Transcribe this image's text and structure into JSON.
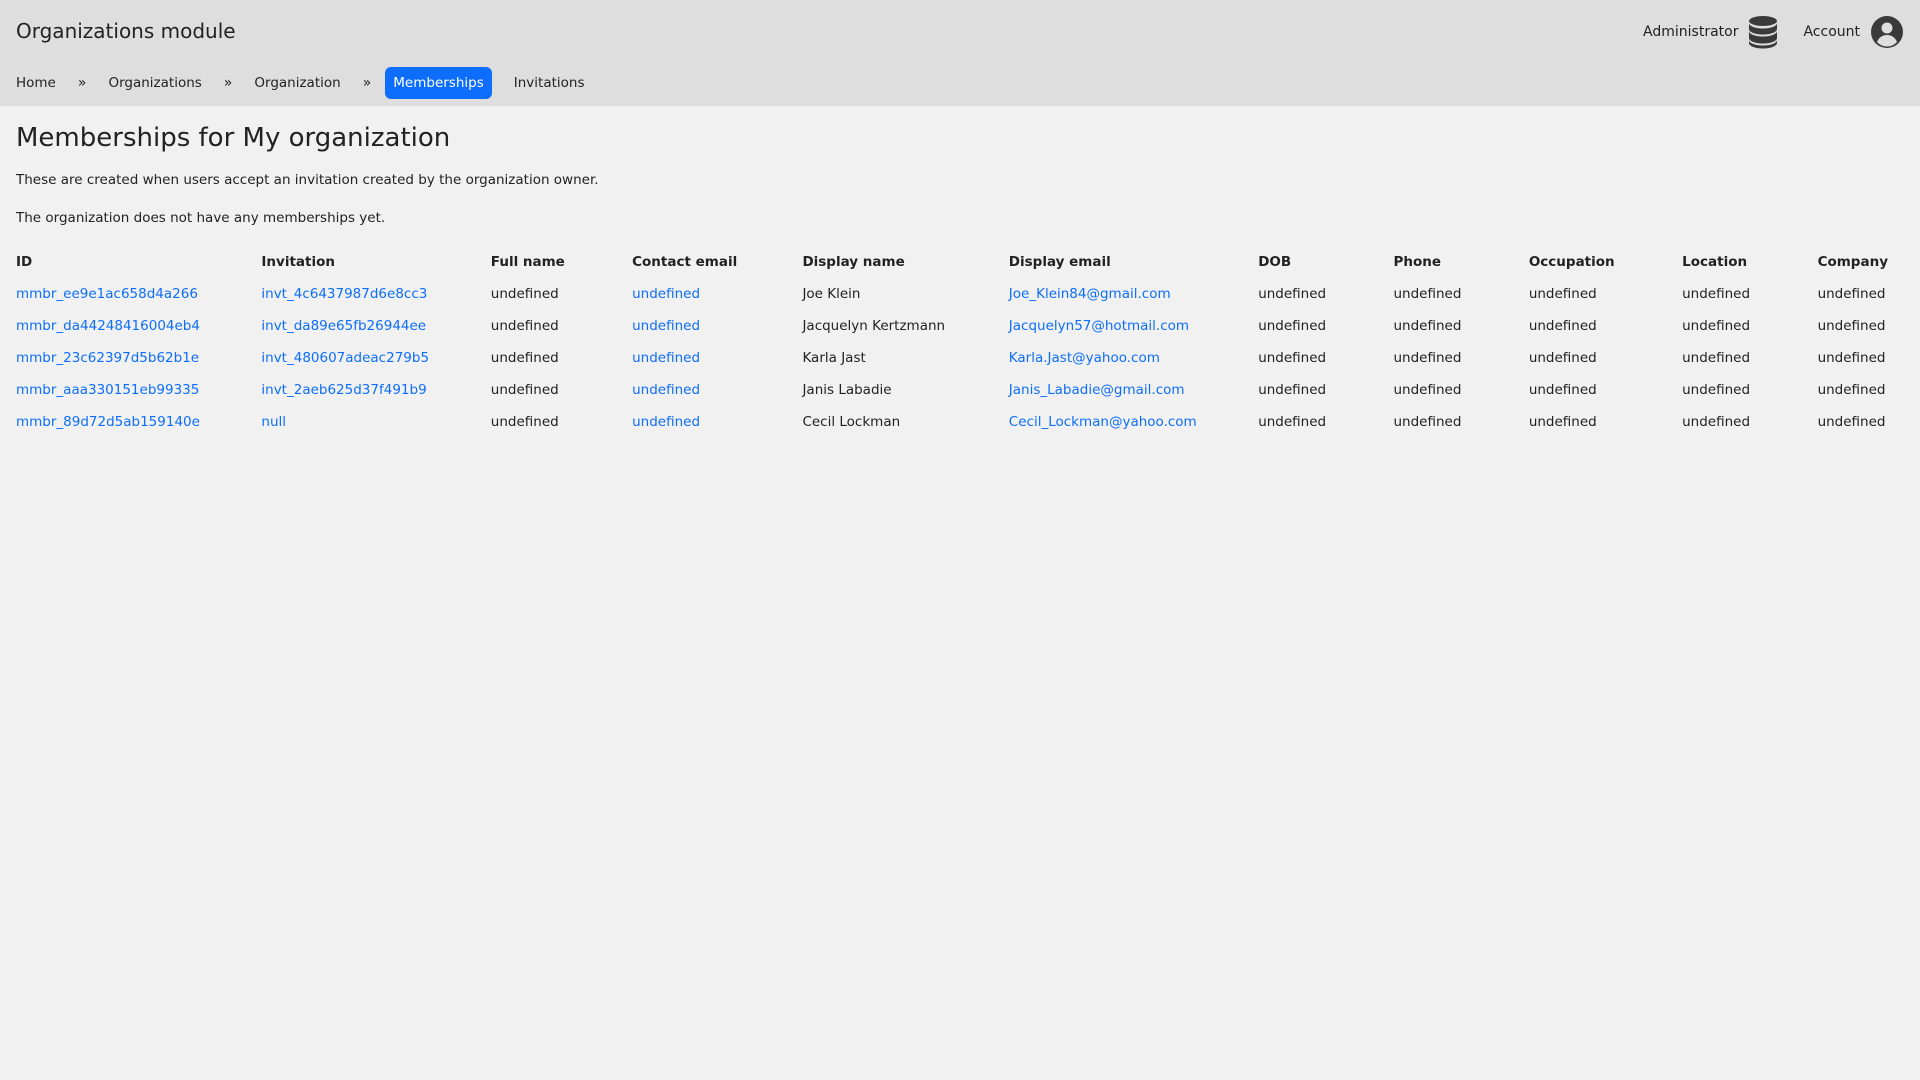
{
  "header": {
    "title": "Organizations module",
    "admin_label": "Administrator",
    "admin_icon": "database-icon",
    "account_label": "Account",
    "account_icon": "user-circle-icon"
  },
  "nav": {
    "items": [
      {
        "label": "Home"
      },
      {
        "label": "Organizations"
      },
      {
        "label": "Organization"
      },
      {
        "label": "Memberships"
      },
      {
        "label": "Invitations"
      }
    ],
    "separator": "»",
    "active_color": "#0d6efd"
  },
  "main": {
    "title": "Memberships for My organization",
    "description": "These are created when users accept an invitation created by the organization owner.",
    "empty_message": "The organization does not have any memberships yet."
  },
  "table": {
    "columns": [
      "ID",
      "Invitation",
      "Full name",
      "Contact email",
      "Display name",
      "Display email",
      "DOB",
      "Phone",
      "Occupation",
      "Location",
      "Company"
    ],
    "rows": [
      [
        "mmbr_ee9e1ac658d4a266",
        "invt_4c6437987d6e8cc3",
        "undefined",
        "undefined",
        "Joe Klein",
        "Joe_Klein84@gmail.com",
        "undefined",
        "undefined",
        "undefined",
        "undefined",
        "undefined"
      ],
      [
        "mmbr_da44248416004eb4",
        "invt_da89e65fb26944ee",
        "undefined",
        "undefined",
        "Jacquelyn Kertzmann",
        "Jacquelyn57@hotmail.com",
        "undefined",
        "undefined",
        "undefined",
        "undefined",
        "undefined"
      ],
      [
        "mmbr_23c62397d5b62b1e",
        "invt_480607adeac279b5",
        "undefined",
        "undefined",
        "Karla Jast",
        "Karla.Jast@yahoo.com",
        "undefined",
        "undefined",
        "undefined",
        "undefined",
        "undefined"
      ],
      [
        "mmbr_aaa330151eb99335",
        "invt_2aeb625d37f491b9",
        "undefined",
        "undefined",
        "Janis Labadie",
        "Janis_Labadie@gmail.com",
        "undefined",
        "undefined",
        "undefined",
        "undefined",
        "undefined"
      ],
      [
        "mmbr_89d72d5ab159140e",
        "null",
        "undefined",
        "undefined",
        "Cecil Lockman",
        "Cecil_Lockman@yahoo.com",
        "undefined",
        "undefined",
        "undefined",
        "undefined",
        "undefined"
      ]
    ]
  },
  "colors": {
    "header_bg": "#dedede",
    "page_bg": "#f1f1f1",
    "link": "#0d6efd"
  }
}
